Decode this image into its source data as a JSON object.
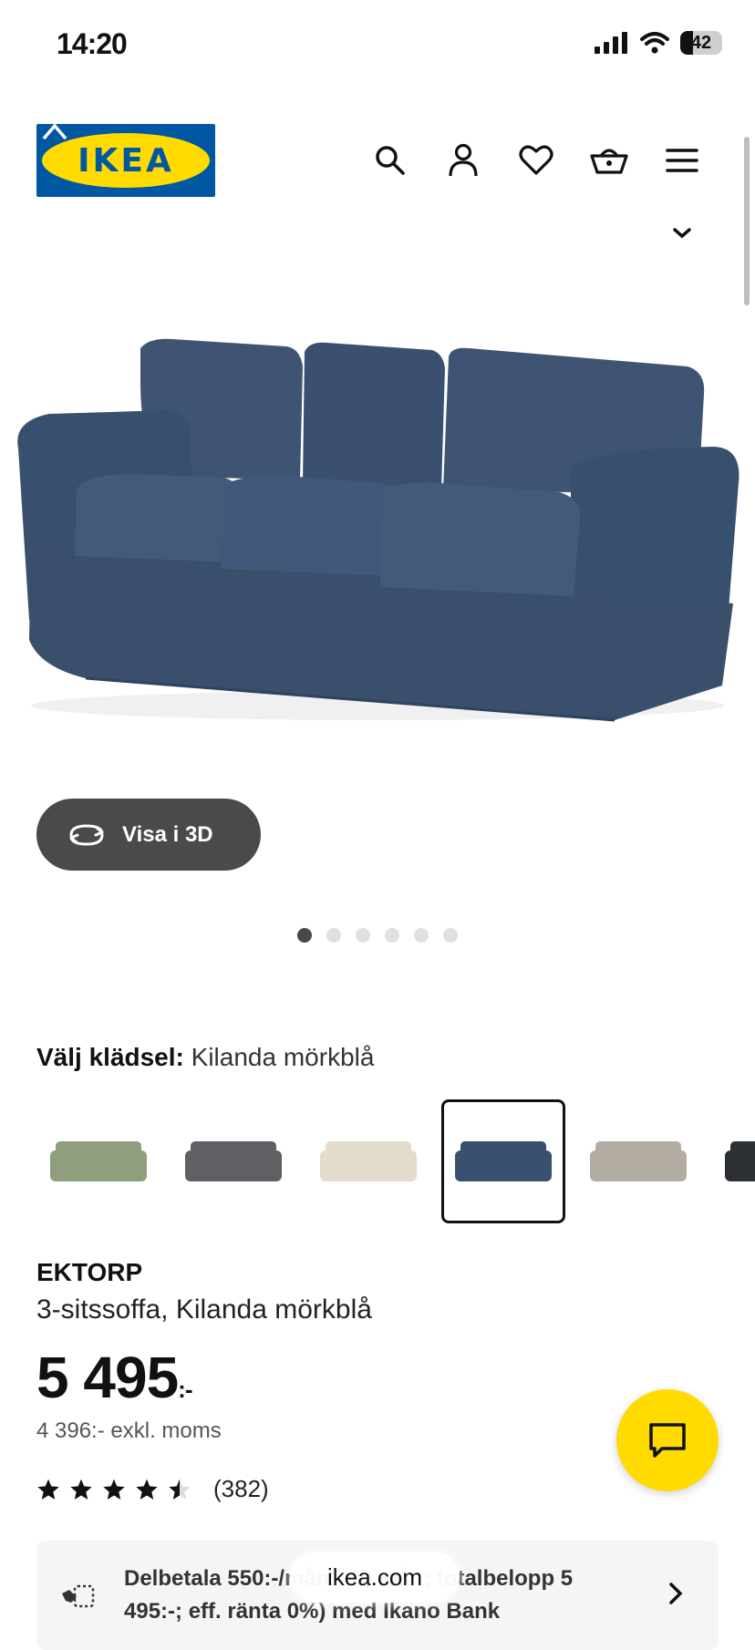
{
  "status_bar": {
    "time": "14:20",
    "battery": "42"
  },
  "header": {
    "logo_text": "IKEA",
    "icons": [
      "search-icon",
      "account-icon",
      "heart-icon",
      "basket-icon",
      "menu-icon"
    ]
  },
  "product_viewer": {
    "view_3d_label": "Visa i 3D",
    "image_count": 6,
    "active_image": 1
  },
  "upholstery": {
    "label": "Välj klädsel:",
    "selected": "Kilanda mörkblå",
    "swatch_colors": [
      "#8f9e7c",
      "#5f6063",
      "#e3dccc",
      "#39506e",
      "#b3aca3",
      "#2c2f34"
    ],
    "selected_index": 3
  },
  "product": {
    "brand": "EKTORP",
    "description": "3-sitssoffa, Kilanda mörkblå",
    "price": "5 495",
    "price_suffix": ":-",
    "price_excl_vat": "4 396:- exkl. moms",
    "rating": 4.5,
    "review_count": "(382)"
  },
  "financing": {
    "text": "Delbetala 550:-/mån i 10 mån; totalbelopp 5 495:-; eff. ränta 0%) med Ikano Bank"
  },
  "browser": {
    "url": "ikea.com"
  },
  "colors": {
    "ikea_blue": "#0058a3",
    "ikea_yellow": "#ffdb00",
    "sofa_blue": "#3d5270"
  }
}
